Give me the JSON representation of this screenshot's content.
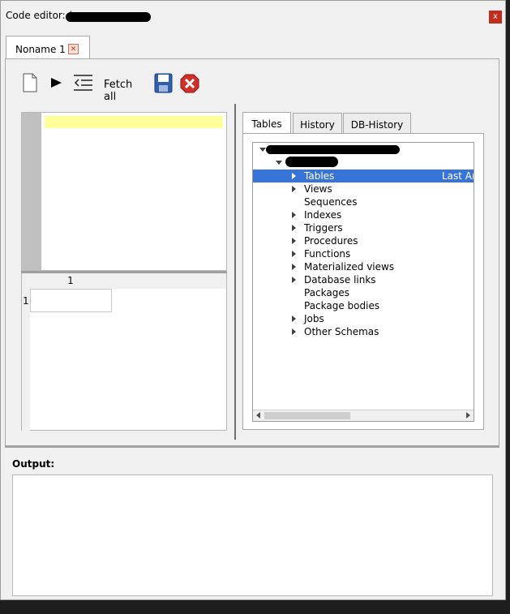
{
  "window": {
    "title": "Code editor: (",
    "close_label": "x"
  },
  "doc_tab": {
    "label": "Noname 1",
    "close_label": "✕"
  },
  "toolbar": {
    "fetch_all_label": "Fetch all",
    "icons": [
      "new-document-icon",
      "execute-icon",
      "explain-plan-icon",
      "save-icon",
      "cancel-icon"
    ]
  },
  "result_grid": {
    "column_headers": [
      "1"
    ],
    "row_numbers": [
      "1"
    ]
  },
  "browser_tabs": [
    "Tables",
    "History",
    "DB-History"
  ],
  "tree": {
    "items": [
      {
        "label": "Tables",
        "expandable": true,
        "selected": true,
        "extra": "Last An"
      },
      {
        "label": "Views",
        "expandable": true
      },
      {
        "label": "Sequences",
        "expandable": false
      },
      {
        "label": "Indexes",
        "expandable": true
      },
      {
        "label": "Triggers",
        "expandable": true
      },
      {
        "label": "Procedures",
        "expandable": true
      },
      {
        "label": "Functions",
        "expandable": true
      },
      {
        "label": "Materialized views",
        "expandable": true
      },
      {
        "label": "Database links",
        "expandable": true
      },
      {
        "label": "Packages",
        "expandable": false
      },
      {
        "label": "Package bodies",
        "expandable": false
      },
      {
        "label": "Jobs",
        "expandable": true
      },
      {
        "label": "Other Schemas",
        "expandable": true
      }
    ]
  },
  "output": {
    "label": "Output:"
  },
  "colors": {
    "selection": "#3874d8",
    "highlight_line": "#ffff99",
    "close_button": "#c42b1c"
  }
}
